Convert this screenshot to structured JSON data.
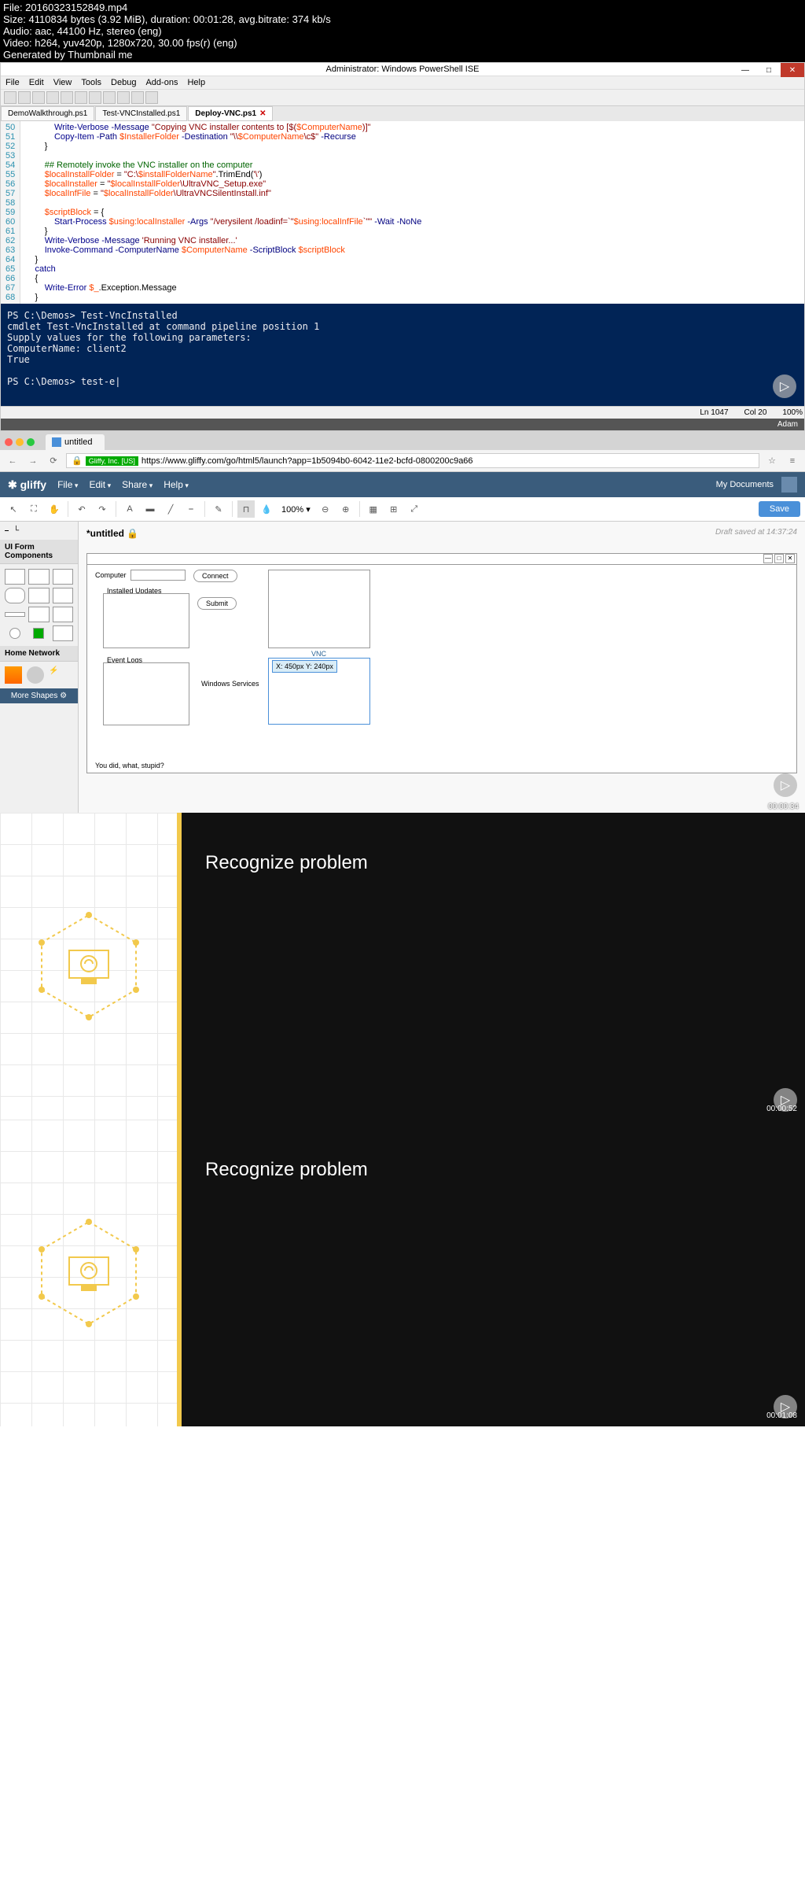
{
  "meta": {
    "file": "File: 20160323152849.mp4",
    "size": "Size: 4110834 bytes (3.92 MiB), duration: 00:01:28, avg.bitrate: 374 kb/s",
    "audio": "Audio: aac, 44100 Hz, stereo (eng)",
    "video": "Video: h264, yuv420p, 1280x720, 30.00 fps(r) (eng)",
    "gen": "Generated by Thumbnail me"
  },
  "ise": {
    "title": "Administrator: Windows PowerShell ISE",
    "menu": [
      "File",
      "Edit",
      "View",
      "Tools",
      "Debug",
      "Add-ons",
      "Help"
    ],
    "tabs": [
      {
        "label": "DemoWalkthrough.ps1"
      },
      {
        "label": "Test-VNCInstalled.ps1"
      },
      {
        "label": "Deploy-VNC.ps1"
      }
    ],
    "gutter": "50\n51\n52\n53\n54\n55\n56\n57\n58\n59\n60\n61\n62\n63\n64\n65\n66\n67\n68",
    "console": "PS C:\\Demos> Test-VncInstalled\ncmdlet Test-VncInstalled at command pipeline position 1\nSupply values for the following parameters:\nComputerName: client2\nTrue\n\nPS C:\\Demos> test-e|",
    "status_ln": "Ln 1047",
    "status_col": "Col 20",
    "status_pct": "100%",
    "account": "Adam"
  },
  "browser": {
    "tab_title": "untitled",
    "security": "Gliffy, Inc. [US]",
    "url": "https://www.gliffy.com/go/html5/launch?app=1b5094b0-6042-11e2-bcfd-0800200c9a66"
  },
  "gliffy": {
    "logo": "✱ gliffy",
    "menu": [
      "File",
      "Edit",
      "Share",
      "Help"
    ],
    "mydocs": "My Documents",
    "zoom": "100% ▾",
    "save": "Save",
    "doc_title": "*untitled",
    "saved_at": "Draft saved at 14:37:24",
    "shapes": {
      "cat1": "UI Form Components",
      "cat2": "Home Network",
      "more": "More Shapes"
    },
    "wireframe": {
      "computer": "Computer",
      "connect": "Connect",
      "installed": "Installed Updates",
      "submit": "Submit",
      "eventlogs": "Event Logs",
      "winservices": "Windows Services",
      "vnc": "VNC",
      "tooltip": "X: 450px Y: 240px",
      "footer": "You did, what, stupid?"
    },
    "timestamp1": "00:00:34"
  },
  "slide": {
    "heading": "Recognize problem",
    "ts1": "00:00:52",
    "ts2": "00:01:08"
  }
}
